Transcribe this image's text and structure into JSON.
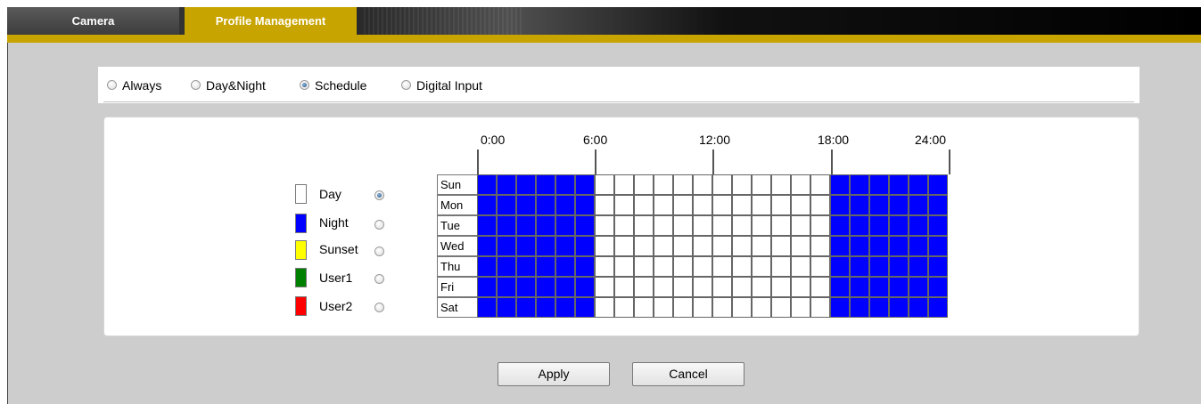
{
  "tabs": {
    "camera_label": "Camera",
    "profile_label": "Profile Management"
  },
  "mode": {
    "selected": "Schedule",
    "options": [
      "Always",
      "Day&Night",
      "Schedule",
      "Digital Input"
    ]
  },
  "legend": {
    "selected": "Day",
    "items": [
      {
        "label": "Day",
        "color": "#ffffff"
      },
      {
        "label": "Night",
        "color": "#0000ff"
      },
      {
        "label": "Sunset",
        "color": "#ffff00"
      },
      {
        "label": "User1",
        "color": "#008000"
      },
      {
        "label": "User2",
        "color": "#ff0000"
      }
    ]
  },
  "schedule": {
    "time_labels": [
      "0:00",
      "6:00",
      "12:00",
      "18:00",
      "24:00"
    ],
    "days": [
      "Sun",
      "Mon",
      "Tue",
      "Wed",
      "Thu",
      "Fri",
      "Sat"
    ],
    "slots_per_day": 24,
    "slot_colors": {
      "D": "#ffffff",
      "N": "#0000ff"
    },
    "day_slots": [
      "NNNNNNDDDDDDDDDDDDNNNNNN",
      "NNNNNNDDDDDDDDDDDDNNNNNN",
      "NNNNNNDDDDDDDDDDDDNNNNNN",
      "NNNNNNDDDDDDDDDDDDNNNNNN",
      "NNNNNNDDDDDDDDDDDDNNNNNN",
      "NNNNNNDDDDDDDDDDDDNNNNNN",
      "NNNNNNDDDDDDDDDDDDNNNNNN"
    ]
  },
  "buttons": {
    "apply_label": "Apply",
    "cancel_label": "Cancel"
  }
}
